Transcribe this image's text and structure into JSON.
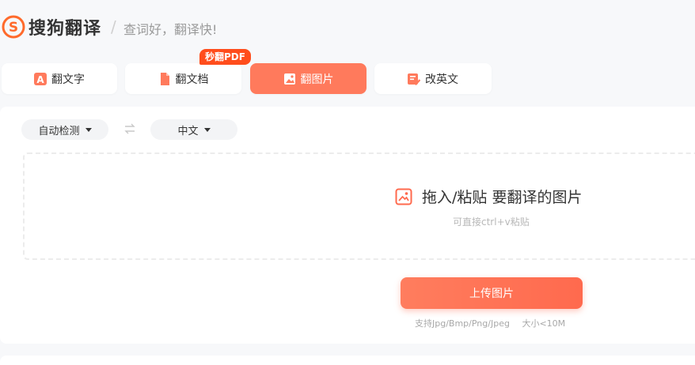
{
  "header": {
    "brand": "搜狗翻译",
    "separator": "/",
    "slogan": "查词好，翻译快!"
  },
  "tabs": [
    {
      "label": "翻文字",
      "icon": "letter-a-icon",
      "active": false
    },
    {
      "label": "翻文档",
      "icon": "document-icon",
      "active": false
    },
    {
      "label": "翻图片",
      "icon": "image-icon",
      "active": true
    },
    {
      "label": "改英文",
      "icon": "edit-check-icon",
      "active": false
    }
  ],
  "badge": "秒翻PDF",
  "languages": {
    "source": "自动检测",
    "target": "中文"
  },
  "dropzone": {
    "title": "拖入/粘贴 要翻译的图片",
    "hint": "可直接ctrl+v粘贴"
  },
  "upload": {
    "button_label": "上传图片",
    "formats": "支持Jpg/Bmp/Png/Jpeg",
    "size_limit": "大小<10M"
  },
  "colors": {
    "accent": "#ff7a5c",
    "badge": "#ff4d1c"
  }
}
